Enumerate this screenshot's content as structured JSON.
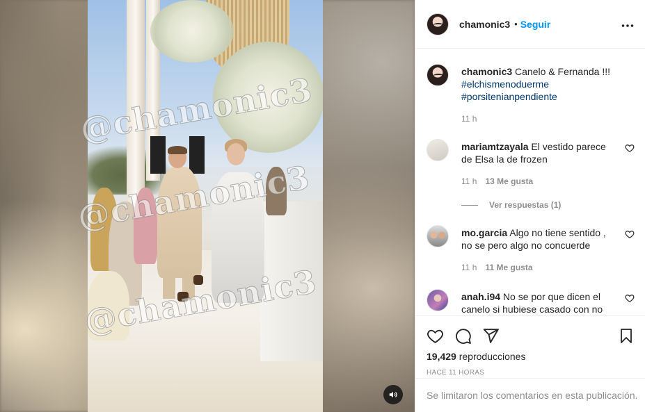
{
  "media": {
    "watermark_text": "@chamonic3",
    "audio_icon": "speaker-volume-icon"
  },
  "header": {
    "username": "chamonic3",
    "separator": "•",
    "follow_label": "Seguir",
    "more_icon": "more-horizontal-icon"
  },
  "caption": {
    "username": "chamonic3",
    "text": "Canelo & Fernanda !!!",
    "hashtags": [
      "#elchismenoduerme",
      "#porsitenianpendiente"
    ],
    "time": "11 h"
  },
  "comments": [
    {
      "username": "mariamtzayala",
      "text": "El vestido parece de Elsa la de frozen",
      "time": "11 h",
      "likes": "13 Me gusta",
      "replies_label": "Ver respuestas (1)",
      "avatar_color": "#d9d6cf"
    },
    {
      "username": "mo.garcia",
      "text": "Algo no tiene sentido , no se pero algo no concuerde",
      "time": "11 h",
      "likes": "11 Me gusta",
      "avatar_color": "#c9b6a1"
    },
    {
      "username": "anah.i94",
      "text": "No se por que dicen el canelo si hubiese casado con no",
      "avatar_color": "#8b7fb8"
    }
  ],
  "actions": {
    "like_icon": "heart-icon",
    "comment_icon": "comment-icon",
    "share_icon": "share-icon",
    "save_icon": "bookmark-icon"
  },
  "stats": {
    "views_count": "19,429",
    "views_label": "reproducciones",
    "time_ago": "HACE 11 HORAS"
  },
  "footer": {
    "comments_limited": "Se limitaron los comentarios en esta publicación."
  },
  "colors": {
    "link_blue": "#0095f6",
    "hashtag_blue": "#00376b",
    "muted_gray": "#8e8e8e"
  }
}
